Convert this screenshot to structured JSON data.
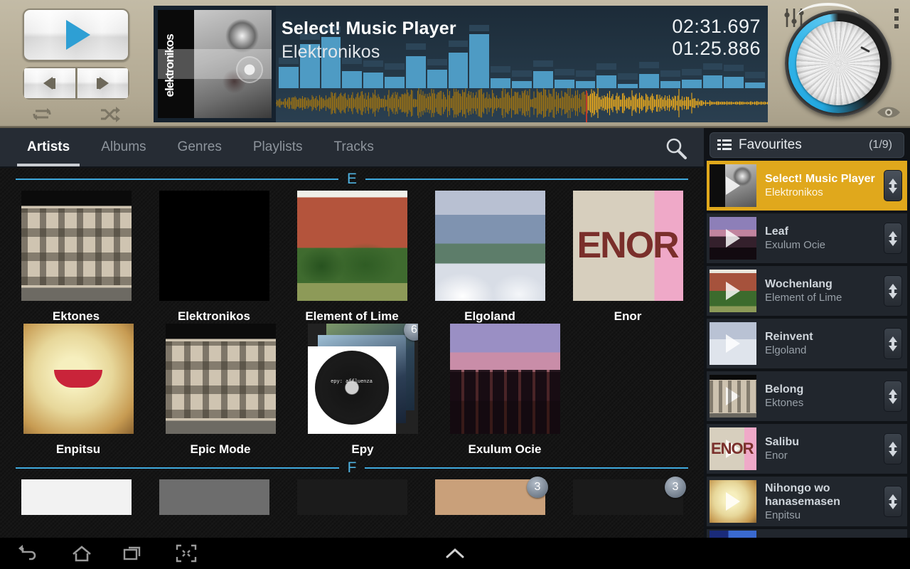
{
  "player": {
    "track_title": "Select! Music Player",
    "artist": "Elektronikos",
    "time_total": "02:31.697",
    "time_elapsed": "01:25.886",
    "album_art_text": "elektronikos",
    "progress_percent": 63,
    "accent_color": "#3fa9dd",
    "waveform_color": "#e8a81d",
    "playhead_color": "#c0392b",
    "spectrum_bars": [
      30,
      62,
      72,
      24,
      22,
      16,
      45,
      26,
      50,
      76,
      14,
      10,
      24,
      12,
      10,
      18,
      6,
      20,
      10,
      12,
      18,
      16,
      8
    ],
    "spectrum_peaks": [
      34,
      68,
      78,
      34,
      30,
      26,
      54,
      32,
      58,
      80,
      22,
      16,
      30,
      18,
      16,
      26,
      12,
      28,
      16,
      18,
      26,
      24,
      14
    ],
    "buttons": {
      "play": "play-icon",
      "previous": "previous-icon",
      "next": "next-icon",
      "repeat": "repeat-icon",
      "shuffle": "shuffle-icon",
      "equalizer": "equalizer-icon",
      "overflow": "overflow-menu-icon",
      "eye": "eye-icon",
      "volume_knob": "volume-knob"
    }
  },
  "tabs": [
    {
      "label": "Artists",
      "active": true
    },
    {
      "label": "Albums",
      "active": false
    },
    {
      "label": "Genres",
      "active": false
    },
    {
      "label": "Playlists",
      "active": false
    },
    {
      "label": "Tracks",
      "active": false
    }
  ],
  "search": {
    "icon": "search-icon"
  },
  "sections": [
    {
      "letter": "E",
      "rows": [
        [
          {
            "label": "Ektones",
            "art": "art-ektones",
            "badge": null
          },
          {
            "label": "Elektronikos",
            "art": "art-elekt",
            "badge": null
          },
          {
            "label": "Element of Lime",
            "art": "art-lime",
            "badge": null
          },
          {
            "label": "Elgoland",
            "art": "art-elgoland",
            "badge": null
          },
          {
            "label": "Enor",
            "art": "art-enor",
            "badge": null
          }
        ],
        [
          {
            "label": "Enpitsu",
            "art": "art-enpitsu",
            "badge": null
          },
          {
            "label": "Epic Mode",
            "art": "art-epicmode",
            "badge": null
          },
          {
            "label": "Epy",
            "art": "stack",
            "badge": "6"
          },
          {
            "label": "Exulum Ocie",
            "art": "art-exulum",
            "badge": null
          }
        ]
      ]
    },
    {
      "letter": "F",
      "partial_row": [
        {
          "badge": null
        },
        {
          "badge": null
        },
        {
          "badge": null
        },
        {
          "badge": "3"
        },
        {
          "badge": "3"
        }
      ]
    }
  ],
  "favourites": {
    "title": "Favourites",
    "count": "(1/9)",
    "list_icon": "list-icon",
    "expand_icon": "chevron-down-icon",
    "items": [
      {
        "song": "Select! Music Player",
        "artist": "Elektronikos",
        "active": true,
        "thumb": "ft-elekt"
      },
      {
        "song": "Leaf",
        "artist": "Exulum Ocie",
        "active": false,
        "thumb": "ft-exulum"
      },
      {
        "song": "Wochenlang",
        "artist": "Element of Lime",
        "active": false,
        "thumb": "ft-lime"
      },
      {
        "song": "Reinvent",
        "artist": "Elgoland",
        "active": false,
        "thumb": "ft-elgoland"
      },
      {
        "song": "Belong",
        "artist": "Ektones",
        "active": false,
        "thumb": "ft-ektones"
      },
      {
        "song": "Salibu",
        "artist": "Enor",
        "active": false,
        "thumb": "ft-enor"
      },
      {
        "song": "Nihongo wo hanasemasen",
        "artist": "Enpitsu",
        "active": false,
        "thumb": "ft-enpitsu"
      }
    ]
  },
  "navbar": {
    "back": "back-icon",
    "home": "home-icon",
    "recents": "recent-apps-icon",
    "shrink": "shrink-screen-icon",
    "expand": "expand-up-icon"
  }
}
